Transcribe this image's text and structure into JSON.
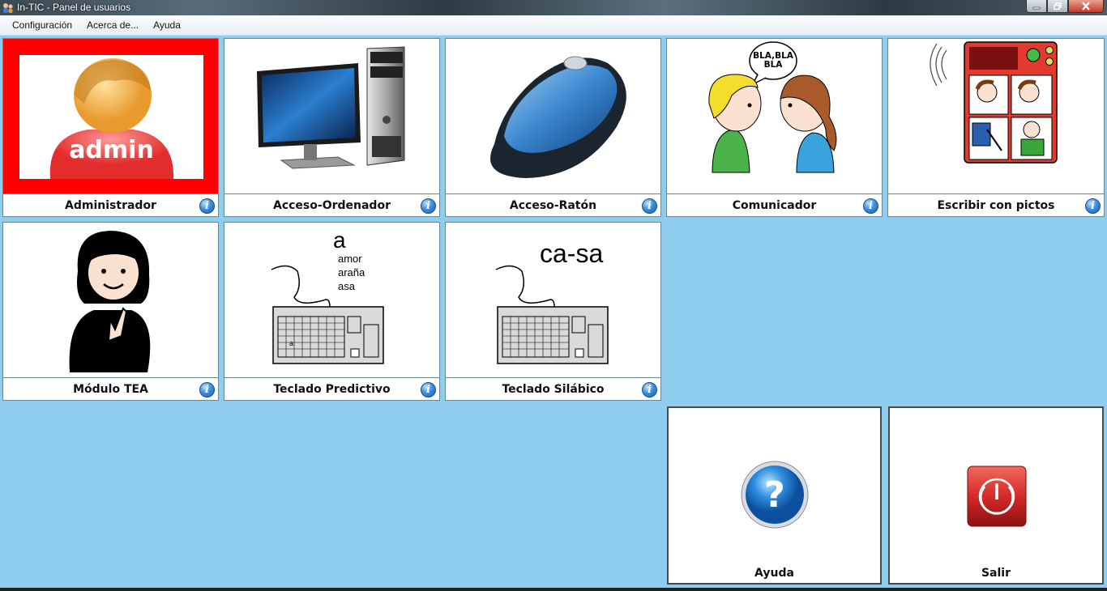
{
  "window": {
    "title": "In-TIC - Panel de usuarios"
  },
  "menu": [
    "Configuración",
    "Acerca de...",
    "Ayuda"
  ],
  "tiles": [
    {
      "label": "Administrador",
      "badge": "admin",
      "info": "i"
    },
    {
      "label": "Acceso-Ordenador",
      "info": "i"
    },
    {
      "label": "Acceso-Ratón",
      "info": "i"
    },
    {
      "label": "Comunicador",
      "bubble": [
        "BLA,BLA",
        "BLA"
      ],
      "info": "i"
    },
    {
      "label": "Escribir con pictos",
      "info": "i"
    },
    {
      "label": "Módulo TEA",
      "info": "i"
    },
    {
      "label": "Teclado Predictivo",
      "letter": "a",
      "words": [
        "amor",
        "araña",
        "asa"
      ],
      "info": "i"
    },
    {
      "label": "Teclado Silábico",
      "syllables": "ca-sa",
      "info": "i"
    }
  ],
  "help": {
    "label": "Ayuda"
  },
  "exit": {
    "label": "Salir"
  },
  "colors": {
    "background": "#8ECDED",
    "admin_frame": "#FF0000",
    "info_icon": "#2F7BD0",
    "exit_button": "#D42A2A"
  }
}
